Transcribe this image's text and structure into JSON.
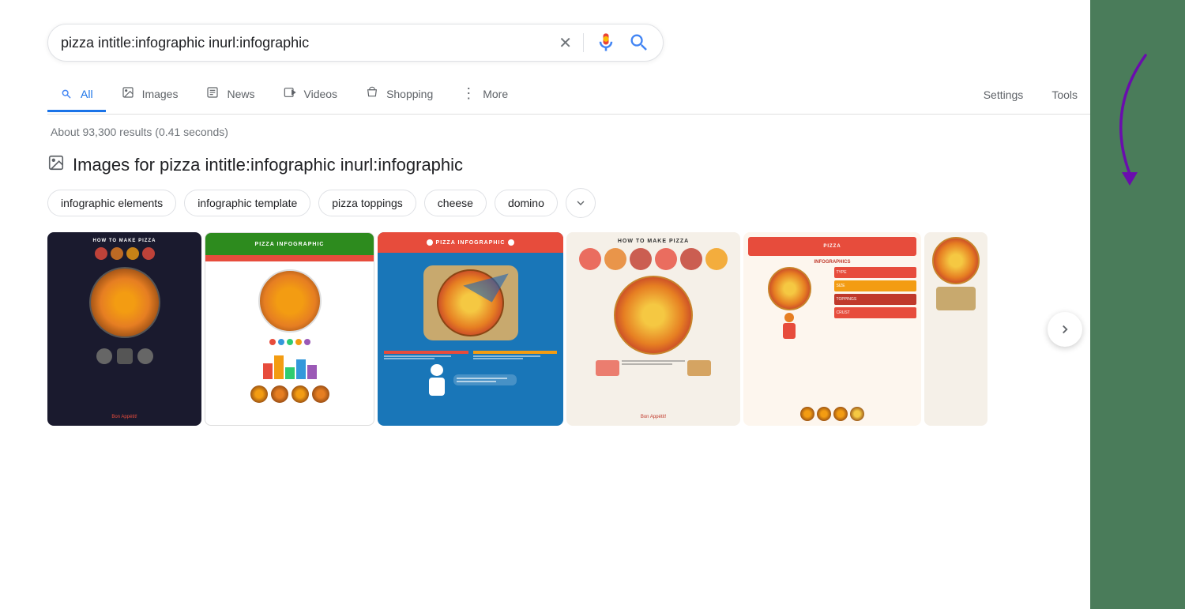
{
  "search": {
    "query": "pizza intitle:infographic inurl:infographic",
    "placeholder": "Search"
  },
  "results": {
    "count_text": "About 93,300 results (0.41 seconds)"
  },
  "images_section": {
    "header": "Images for pizza intitle:infographic inurl:infographic"
  },
  "nav": {
    "tabs": [
      {
        "id": "all",
        "label": "All",
        "active": true,
        "icon": "🔍"
      },
      {
        "id": "images",
        "label": "Images",
        "active": false,
        "icon": "🖼"
      },
      {
        "id": "news",
        "label": "News",
        "active": false,
        "icon": "📰"
      },
      {
        "id": "videos",
        "label": "Videos",
        "active": false,
        "icon": "▶"
      },
      {
        "id": "shopping",
        "label": "Shopping",
        "active": false,
        "icon": "🏷"
      },
      {
        "id": "more",
        "label": "More",
        "active": false,
        "icon": "⋮"
      }
    ],
    "settings_label": "Settings",
    "tools_label": "Tools"
  },
  "filter_chips": [
    {
      "label": "infographic elements"
    },
    {
      "label": "infographic template"
    },
    {
      "label": "pizza toppings"
    },
    {
      "label": "cheese"
    },
    {
      "label": "domino"
    }
  ],
  "image_tiles": [
    {
      "alt": "How to Make Pizza dark infographic",
      "bg": "#1a1a2e",
      "title": "HOW TO MAKE PIZZA",
      "subtitle": "Bon Appétit!"
    },
    {
      "alt": "Pizza Infographic green header",
      "bg": "#2d6b1e",
      "title": "PIZZA INFOGRAPHIC"
    },
    {
      "alt": "Pizza Infographic blue background",
      "bg": "#1976b8",
      "title": "PIZZA INFOGRAPHIC"
    },
    {
      "alt": "How to Make Pizza beige",
      "bg": "#f5f0e8",
      "title": "HOW TO MAKE PIZZA",
      "subtitle": "Bon Appétit!"
    },
    {
      "alt": "Pizza Infographics red",
      "bg": "#faf0e6",
      "title": "PIZZA INFOGRAPHICS"
    },
    {
      "alt": "Partial pizza tile",
      "bg": "#f5f0e8",
      "title": ""
    }
  ],
  "icons": {
    "search": "🔍",
    "clear": "✕",
    "mic": "🎤",
    "image_placeholder": "🖼",
    "chevron_down": "⌄",
    "chevron_right": "›"
  }
}
